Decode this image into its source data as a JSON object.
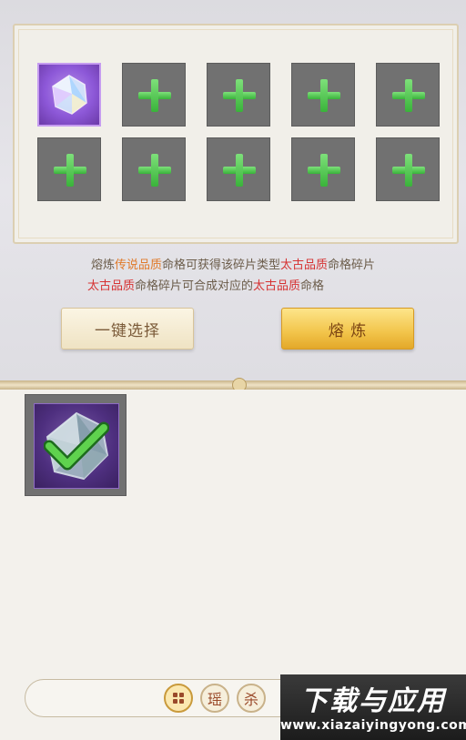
{
  "slots": {
    "filled_item": "legendary-fate-crystal",
    "empty_icon": "plus-icon",
    "empty_count": 9
  },
  "description": {
    "line1": [
      {
        "text": "熔炼",
        "color": "normal"
      },
      {
        "text": "传说品质",
        "color": "orange"
      },
      {
        "text": "命格可获得该碎片类型",
        "color": "normal"
      },
      {
        "text": "太古品质",
        "color": "red"
      },
      {
        "text": "命格碎片",
        "color": "normal"
      }
    ],
    "line2": [
      {
        "text": "太古品质",
        "color": "red"
      },
      {
        "text": "命格碎片可合成对应的",
        "color": "normal"
      },
      {
        "text": "太古品质",
        "color": "red"
      },
      {
        "text": "命格",
        "color": "normal"
      }
    ]
  },
  "buttons": {
    "one_click_select": "一键选择",
    "smelt": "熔 炼"
  },
  "inventory": {
    "item_icon": "selected-check-icon"
  },
  "filters": {
    "tab2": "瑶",
    "tab3": "杀"
  },
  "watermark": {
    "title": "下载与应用",
    "url": "www.xiazaiyingyong.com"
  },
  "colors": {
    "orange": "#e07a2a",
    "red": "#d63232",
    "plus_green": "#39b33a",
    "gold_button": "#f2c44a"
  }
}
